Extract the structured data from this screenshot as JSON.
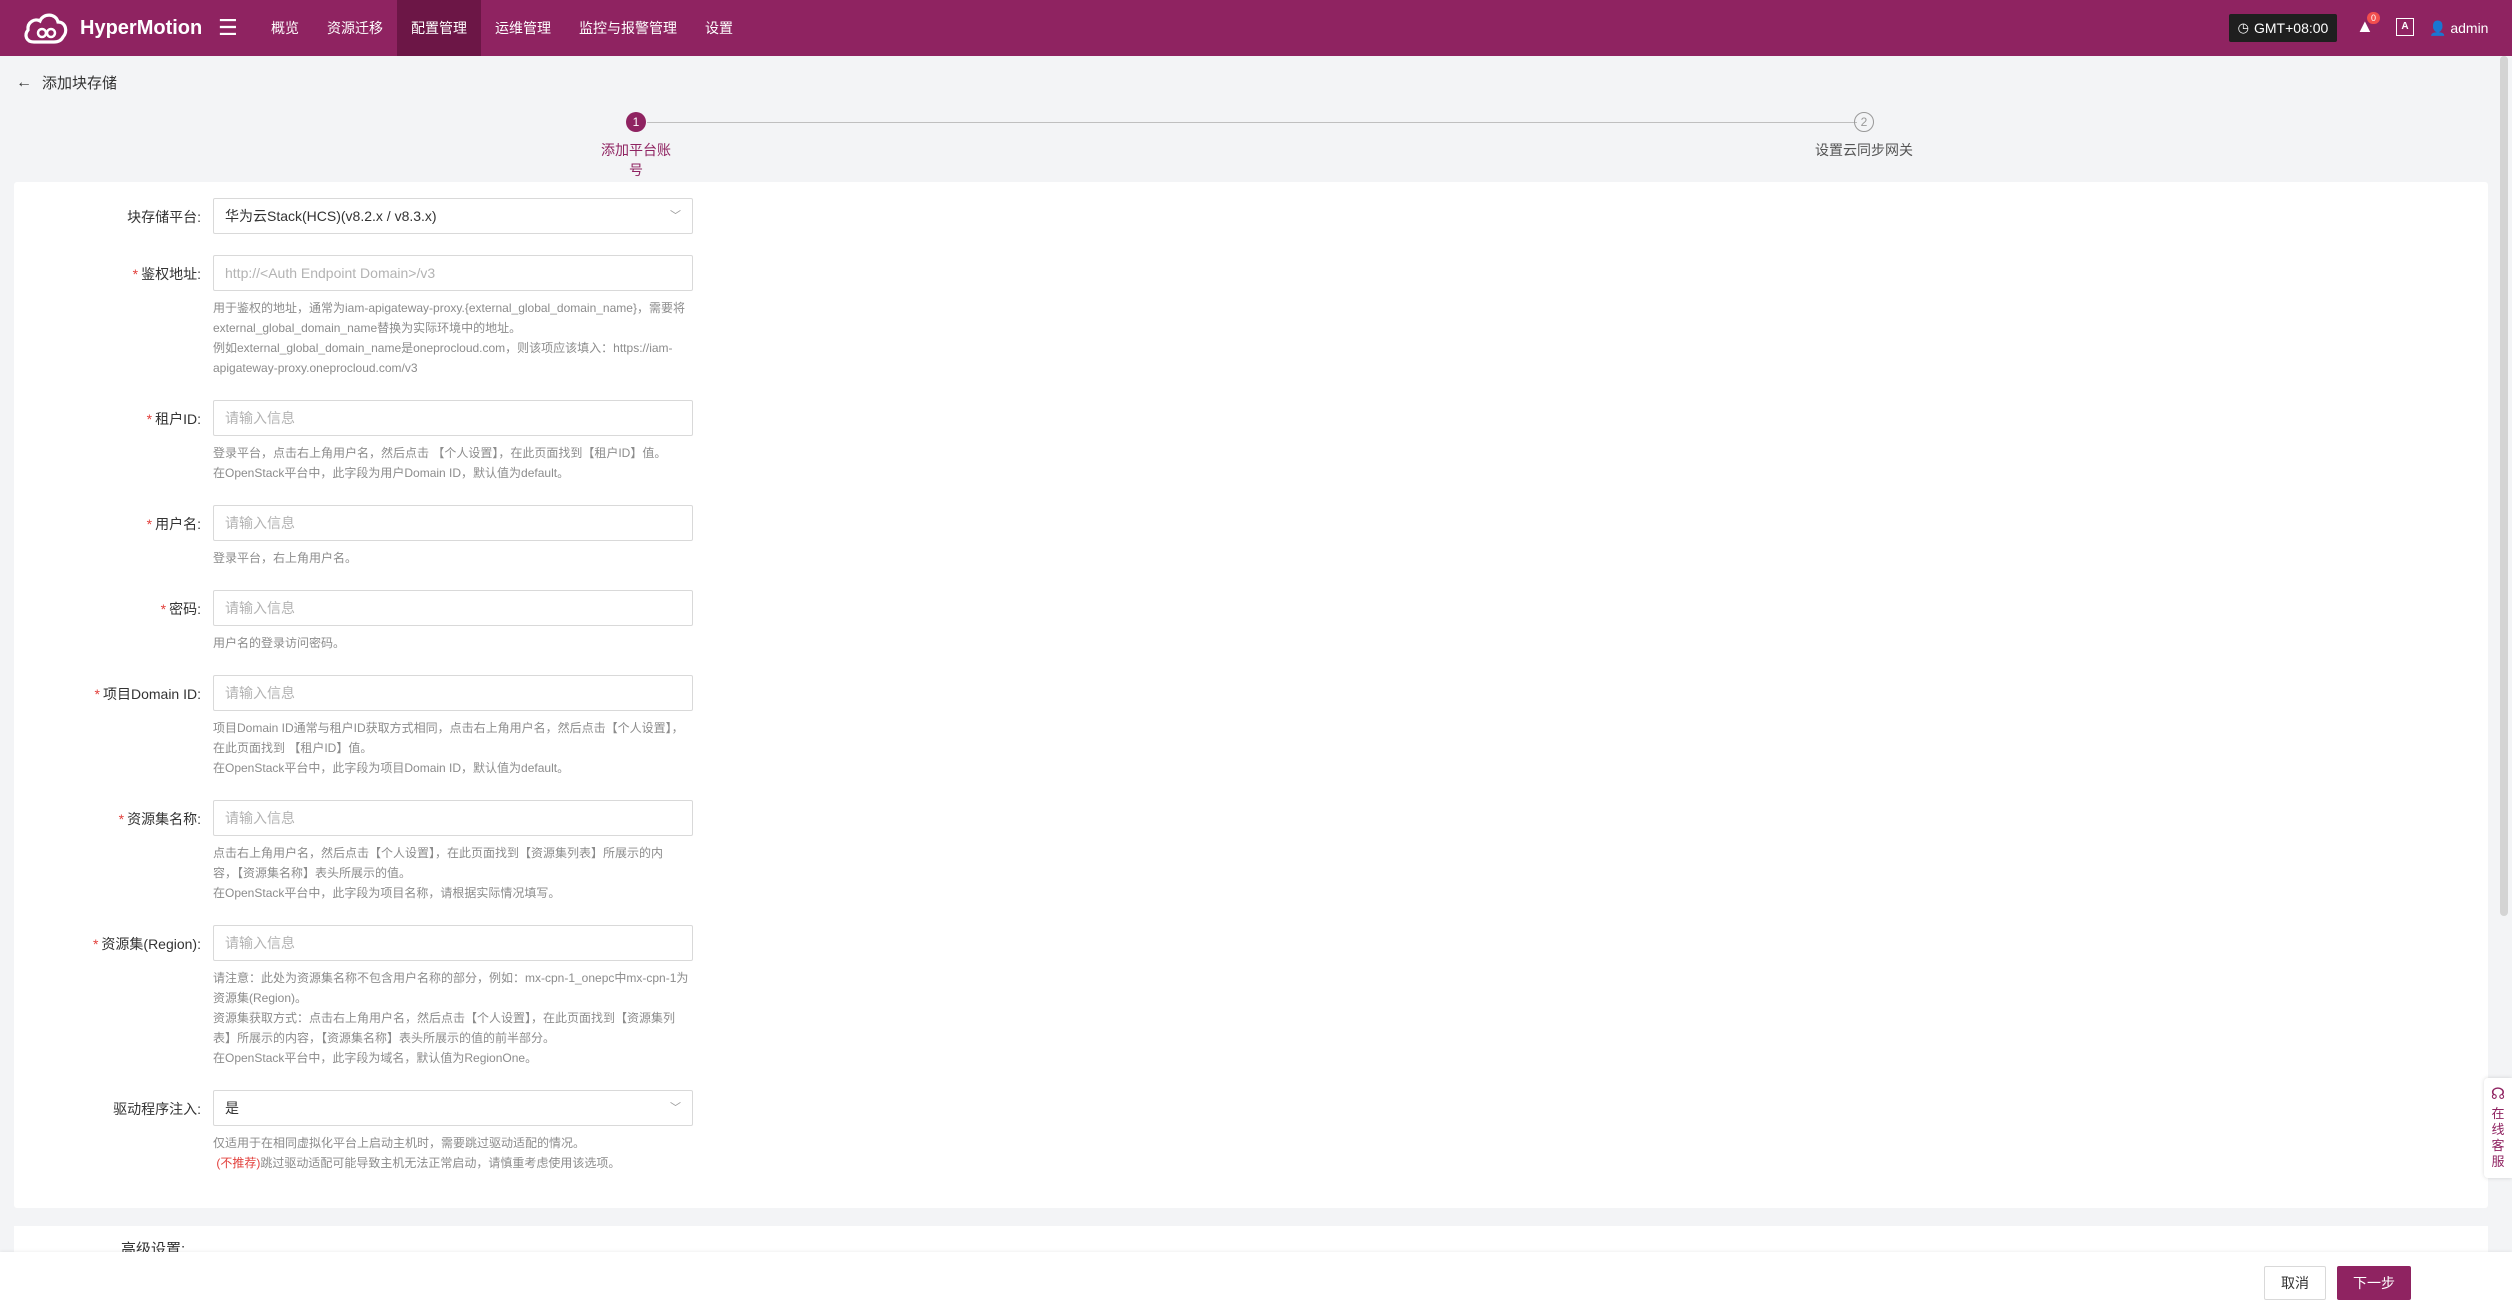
{
  "app": {
    "title": "HyperMotion"
  },
  "nav": {
    "items": [
      {
        "label": "概览"
      },
      {
        "label": "资源迁移"
      },
      {
        "label": "配置管理",
        "active": true
      },
      {
        "label": "运维管理"
      },
      {
        "label": "监控与报警管理"
      },
      {
        "label": "设置"
      }
    ],
    "timezone": "GMT+08:00",
    "notification_count": "0",
    "lang_icon": "A",
    "user": "admin"
  },
  "page": {
    "title": "添加块存储"
  },
  "steps": [
    {
      "number": "1",
      "label": "添加平台账号",
      "active": true
    },
    {
      "number": "2",
      "label": "设置云同步网关",
      "active": false
    }
  ],
  "form": {
    "platform": {
      "label": "块存储平台:",
      "value": "华为云Stack(HCS)(v8.2.x / v8.3.x)"
    },
    "auth_url": {
      "label": "鉴权地址:",
      "placeholder": "http://<Auth Endpoint Domain>/v3",
      "help": [
        "用于鉴权的地址，通常为iam-apigateway-proxy.{external_global_domain_name}，需要将",
        "external_global_domain_name替换为实际环境中的地址。",
        "例如external_global_domain_name是oneprocloud.com，则该项应该填入：https://iam-",
        "apigateway-proxy.oneprocloud.com/v3"
      ]
    },
    "tenant_id": {
      "label": "租户ID:",
      "placeholder": "请输入信息",
      "help": [
        "登录平台，点击右上角用户名，然后点击 【个人设置】，在此页面找到【租户ID】值。",
        "在OpenStack平台中，此字段为用户Domain ID，默认值为default。"
      ]
    },
    "username": {
      "label": "用户名:",
      "placeholder": "请输入信息",
      "help": [
        "登录平台，右上角用户名。"
      ]
    },
    "password": {
      "label": "密码:",
      "placeholder": "请输入信息",
      "help": [
        "用户名的登录访问密码。"
      ]
    },
    "project_domain": {
      "label": "项目Domain ID:",
      "placeholder": "请输入信息",
      "help": [
        "项目Domain ID通常与租户ID获取方式相同，点击右上角用户名，然后点击【个人设置】，",
        "在此页面找到 【租户ID】值。",
        "在OpenStack平台中，此字段为项目Domain ID，默认值为default。"
      ]
    },
    "resource_set_name": {
      "label": "资源集名称:",
      "placeholder": "请输入信息",
      "help": [
        "点击右上角用户名，然后点击【个人设置】，在此页面找到【资源集列表】所展示的内",
        "容，【资源集名称】表头所展示的值。",
        "在OpenStack平台中，此字段为项目名称，请根据实际情况填写。"
      ]
    },
    "region": {
      "label": "资源集(Region):",
      "placeholder": "请输入信息",
      "help": [
        "请注意：此处为资源集名称不包含用户名称的部分，例如：mx-cpn-1_onepc中mx-cpn-1为",
        "资源集(Region)。",
        "资源集获取方式：点击右上角用户名，然后点击【个人设置】，在此页面找到【资源集列",
        "表】所展示的内容，【资源集名称】表头所展示的值的前半部分。",
        "在OpenStack平台中，此字段为域名，默认值为RegionOne。"
      ]
    },
    "driver": {
      "label": "驱动程序注入:",
      "value": "是",
      "help": [
        "仅适用于在相同虚拟化平台上启动主机时，需要跳过驱动适配的情况。"
      ],
      "warning_tag": "(不推荐)",
      "warning_text": "跳过驱动适配可能导致主机无法正常启动，请慎重考虑使用该选项。"
    },
    "advanced": {
      "label": "高级设置:"
    }
  },
  "footer": {
    "cancel": "取消",
    "next": "下一步"
  },
  "service": {
    "label": "在线客服"
  },
  "colors": {
    "brand": "#8f2361",
    "required": "#e2403c"
  }
}
